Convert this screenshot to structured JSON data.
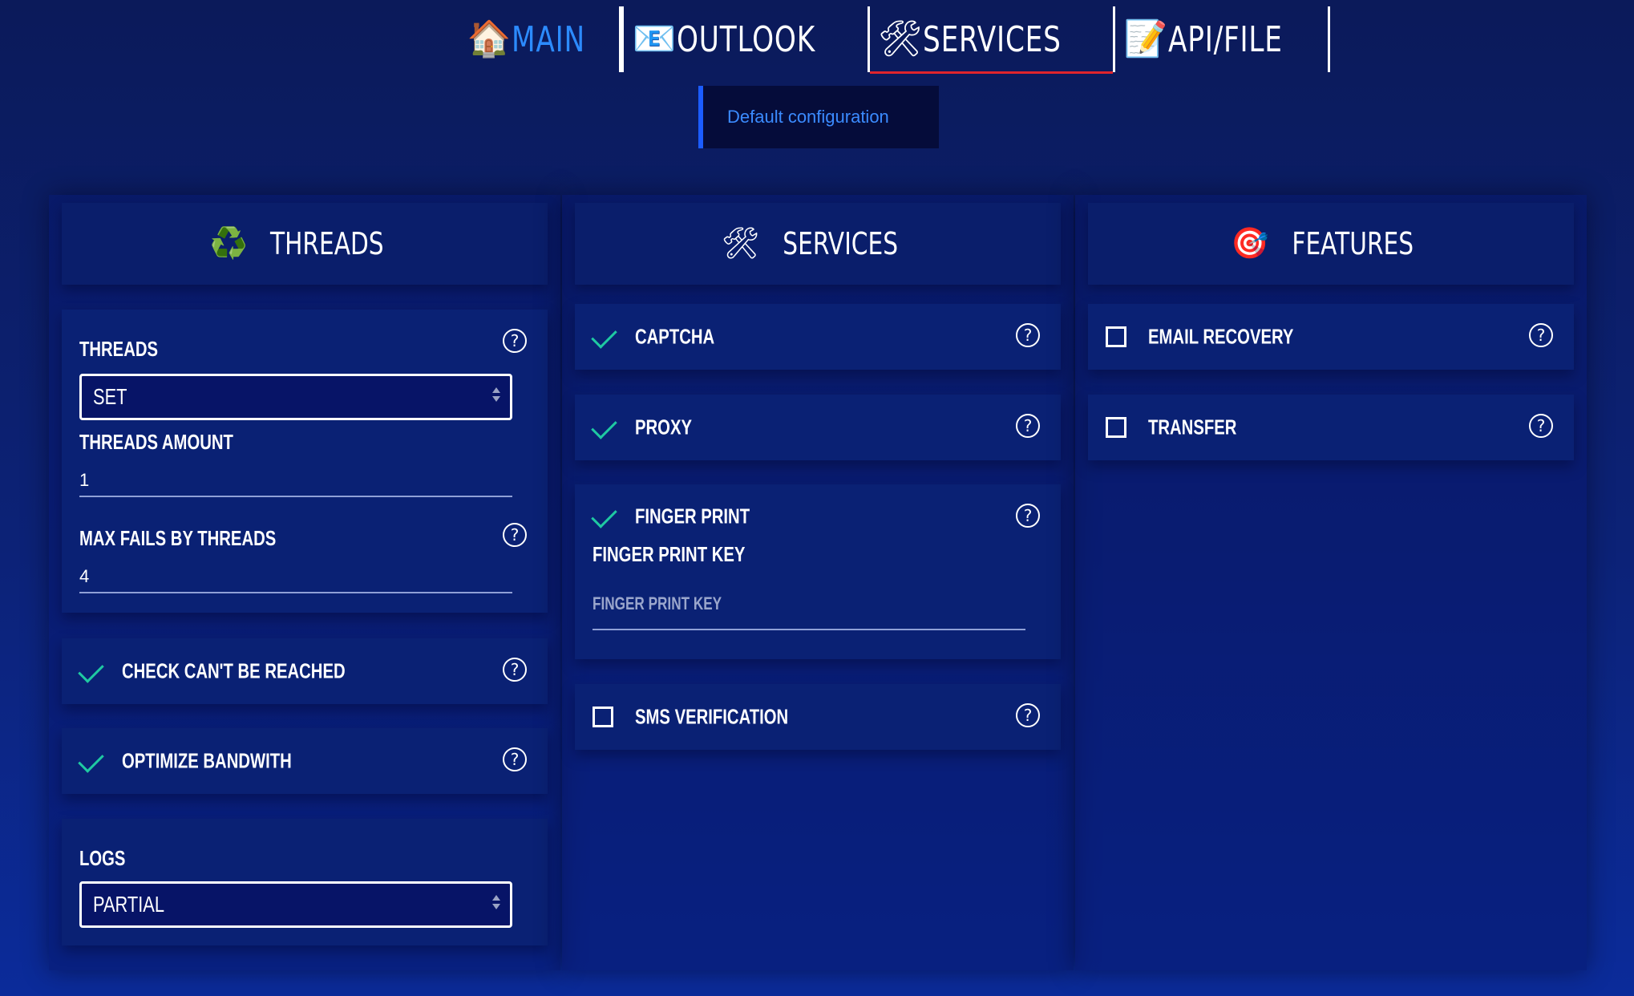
{
  "tabs": [
    {
      "label": "MAIN",
      "icon": "house-icon",
      "active": false
    },
    {
      "label": "OUTLOOK",
      "icon": "envelope-icon",
      "active": false
    },
    {
      "label": "SERVICES",
      "icon": "tools-icon",
      "active": true
    },
    {
      "label": "API/FILE",
      "icon": "document-pencil-icon",
      "active": false
    }
  ],
  "config": {
    "label": "Default configuration"
  },
  "threads": {
    "title": "THREADS",
    "icon": "recycle-icon",
    "threads_label": "THREADS",
    "threads_select": "SET",
    "threads_amount_label": "THREADS AMOUNT",
    "threads_amount_value": "1",
    "max_fails_label": "MAX FAILS BY THREADS",
    "max_fails_value": "4",
    "check_cant_be_reached": {
      "label": "CHECK CAN'T BE REACHED",
      "checked": true
    },
    "optimize_bandwith": {
      "label": "OPTIMIZE BANDWITH",
      "checked": true
    },
    "logs_label": "LOGS",
    "logs_select": "PARTIAL"
  },
  "services": {
    "title": "SERVICES",
    "icon": "tools-icon",
    "captcha": {
      "label": "CAPTCHA",
      "checked": true
    },
    "proxy": {
      "label": "PROXY",
      "checked": true
    },
    "finger_print": {
      "label": "FINGER PRINT",
      "checked": true,
      "key_label": "FINGER PRINT KEY",
      "key_placeholder": "FINGER PRINT KEY",
      "key_value": ""
    },
    "sms_verification": {
      "label": "SMS VERIFICATION",
      "checked": false
    }
  },
  "features": {
    "title": "FEATURES",
    "icon": "target-icon",
    "email_recovery": {
      "label": "EMAIL RECOVERY",
      "checked": false
    },
    "transfer": {
      "label": "TRANSFER",
      "checked": false
    }
  },
  "help_symbol": "?",
  "colors": {
    "accent_blue": "#2c8bff",
    "active_tab_underline": "#e0242c",
    "check_green": "#1fc9a2"
  }
}
